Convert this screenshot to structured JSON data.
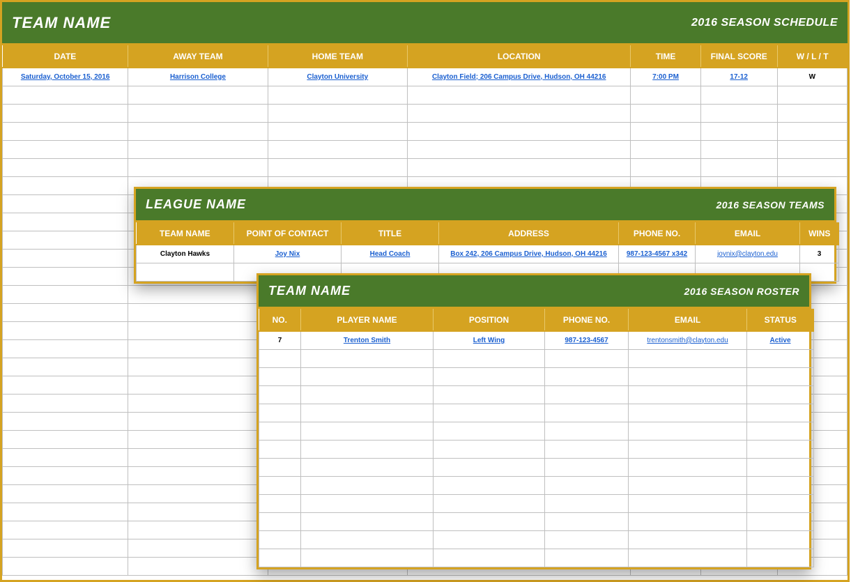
{
  "schedule": {
    "title_left": "TEAM NAME",
    "title_right": "2016 SEASON SCHEDULE",
    "headers": [
      "DATE",
      "AWAY TEAM",
      "HOME TEAM",
      "LOCATION",
      "TIME",
      "FINAL SCORE",
      "W / L / T"
    ],
    "row": {
      "date": "Saturday, October 15, 2016",
      "away": "Harrison College",
      "home": "Clayton University",
      "location": "Clayton Field; 206 Campus Drive, Hudson, OH  44216",
      "time": "7:00 PM",
      "score": "17-12",
      "wlt": "W"
    },
    "empty_rows": 27
  },
  "league": {
    "title_left": "LEAGUE NAME",
    "title_right": "2016 SEASON TEAMS",
    "headers": [
      "TEAM NAME",
      "POINT OF CONTACT",
      "TITLE",
      "ADDRESS",
      "PHONE NO.",
      "EMAIL",
      "WINS"
    ],
    "row": {
      "team": "Clayton Hawks",
      "poc": "Joy Nix",
      "title": "Head Coach",
      "address": "Box 242, 206 Campus Drive, Hudson, OH  44216",
      "phone": "987-123-4567 x342",
      "email": "joynix@clayton.edu",
      "wins": "3"
    },
    "empty_rows": 1
  },
  "roster": {
    "title_left": "TEAM NAME",
    "title_right": "2016 SEASON ROSTER",
    "headers": [
      "NO.",
      "PLAYER NAME",
      "POSITION",
      "PHONE NO.",
      "EMAIL",
      "STATUS"
    ],
    "row": {
      "no": "7",
      "player": "Trenton Smith",
      "position": "Left Wing",
      "phone": "987-123-4567",
      "email": "trentonsmith@clayton.edu",
      "status": "Active"
    },
    "empty_rows": 12
  }
}
